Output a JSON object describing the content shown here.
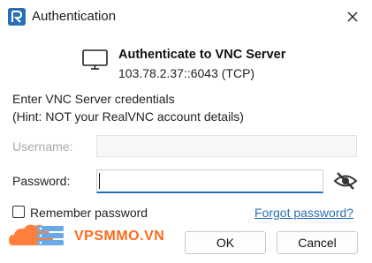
{
  "window": {
    "title": "Authentication",
    "app_icon": "realvnc-logo",
    "close_icon": "close-icon"
  },
  "header": {
    "icon": "monitor-icon",
    "heading": "Authenticate to VNC Server",
    "address": "103.78.2.37::6043 (TCP)"
  },
  "instructions": {
    "line1": "Enter VNC Server credentials",
    "line2": "(Hint: NOT your RealVNC account details)"
  },
  "form": {
    "username_label": "Username:",
    "username_value": "",
    "password_label": "Password:",
    "password_value": "",
    "toggle_visibility_icon": "eye-slash-icon"
  },
  "options": {
    "remember_label": "Remember password",
    "remember_checked": false,
    "forgot_label": "Forgot password?"
  },
  "watermark": {
    "text": "VPSMMO.VN",
    "color": "#ff6a1a"
  },
  "buttons": {
    "ok_label": "OK",
    "cancel_label": "Cancel"
  },
  "colors": {
    "accent": "#1f6fbf",
    "link": "#2a6fb3"
  }
}
